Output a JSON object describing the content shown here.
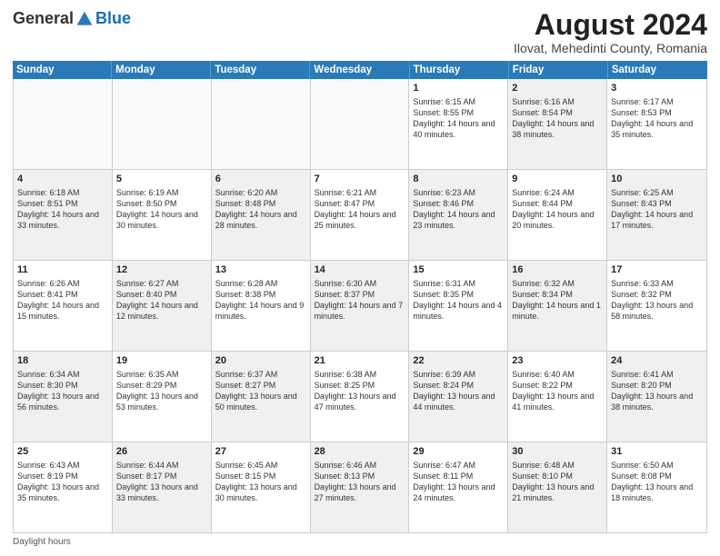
{
  "header": {
    "logo_general": "General",
    "logo_blue": "Blue",
    "title": "August 2024",
    "subtitle": "Ilovat, Mehedinti County, Romania"
  },
  "days_of_week": [
    "Sunday",
    "Monday",
    "Tuesday",
    "Wednesday",
    "Thursday",
    "Friday",
    "Saturday"
  ],
  "footer": "Daylight hours",
  "weeks": [
    [
      {
        "day": "",
        "sunrise": "",
        "sunset": "",
        "daylight": "",
        "shaded": false,
        "empty": true
      },
      {
        "day": "",
        "sunrise": "",
        "sunset": "",
        "daylight": "",
        "shaded": false,
        "empty": true
      },
      {
        "day": "",
        "sunrise": "",
        "sunset": "",
        "daylight": "",
        "shaded": false,
        "empty": true
      },
      {
        "day": "",
        "sunrise": "",
        "sunset": "",
        "daylight": "",
        "shaded": false,
        "empty": true
      },
      {
        "day": "1",
        "sunrise": "Sunrise: 6:15 AM",
        "sunset": "Sunset: 8:55 PM",
        "daylight": "Daylight: 14 hours and 40 minutes.",
        "shaded": false,
        "empty": false
      },
      {
        "day": "2",
        "sunrise": "Sunrise: 6:16 AM",
        "sunset": "Sunset: 8:54 PM",
        "daylight": "Daylight: 14 hours and 38 minutes.",
        "shaded": true,
        "empty": false
      },
      {
        "day": "3",
        "sunrise": "Sunrise: 6:17 AM",
        "sunset": "Sunset: 8:53 PM",
        "daylight": "Daylight: 14 hours and 35 minutes.",
        "shaded": false,
        "empty": false
      }
    ],
    [
      {
        "day": "4",
        "sunrise": "Sunrise: 6:18 AM",
        "sunset": "Sunset: 8:51 PM",
        "daylight": "Daylight: 14 hours and 33 minutes.",
        "shaded": true,
        "empty": false
      },
      {
        "day": "5",
        "sunrise": "Sunrise: 6:19 AM",
        "sunset": "Sunset: 8:50 PM",
        "daylight": "Daylight: 14 hours and 30 minutes.",
        "shaded": false,
        "empty": false
      },
      {
        "day": "6",
        "sunrise": "Sunrise: 6:20 AM",
        "sunset": "Sunset: 8:48 PM",
        "daylight": "Daylight: 14 hours and 28 minutes.",
        "shaded": true,
        "empty": false
      },
      {
        "day": "7",
        "sunrise": "Sunrise: 6:21 AM",
        "sunset": "Sunset: 8:47 PM",
        "daylight": "Daylight: 14 hours and 25 minutes.",
        "shaded": false,
        "empty": false
      },
      {
        "day": "8",
        "sunrise": "Sunrise: 6:23 AM",
        "sunset": "Sunset: 8:46 PM",
        "daylight": "Daylight: 14 hours and 23 minutes.",
        "shaded": true,
        "empty": false
      },
      {
        "day": "9",
        "sunrise": "Sunrise: 6:24 AM",
        "sunset": "Sunset: 8:44 PM",
        "daylight": "Daylight: 14 hours and 20 minutes.",
        "shaded": false,
        "empty": false
      },
      {
        "day": "10",
        "sunrise": "Sunrise: 6:25 AM",
        "sunset": "Sunset: 8:43 PM",
        "daylight": "Daylight: 14 hours and 17 minutes.",
        "shaded": true,
        "empty": false
      }
    ],
    [
      {
        "day": "11",
        "sunrise": "Sunrise: 6:26 AM",
        "sunset": "Sunset: 8:41 PM",
        "daylight": "Daylight: 14 hours and 15 minutes.",
        "shaded": false,
        "empty": false
      },
      {
        "day": "12",
        "sunrise": "Sunrise: 6:27 AM",
        "sunset": "Sunset: 8:40 PM",
        "daylight": "Daylight: 14 hours and 12 minutes.",
        "shaded": true,
        "empty": false
      },
      {
        "day": "13",
        "sunrise": "Sunrise: 6:28 AM",
        "sunset": "Sunset: 8:38 PM",
        "daylight": "Daylight: 14 hours and 9 minutes.",
        "shaded": false,
        "empty": false
      },
      {
        "day": "14",
        "sunrise": "Sunrise: 6:30 AM",
        "sunset": "Sunset: 8:37 PM",
        "daylight": "Daylight: 14 hours and 7 minutes.",
        "shaded": true,
        "empty": false
      },
      {
        "day": "15",
        "sunrise": "Sunrise: 6:31 AM",
        "sunset": "Sunset: 8:35 PM",
        "daylight": "Daylight: 14 hours and 4 minutes.",
        "shaded": false,
        "empty": false
      },
      {
        "day": "16",
        "sunrise": "Sunrise: 6:32 AM",
        "sunset": "Sunset: 8:34 PM",
        "daylight": "Daylight: 14 hours and 1 minute.",
        "shaded": true,
        "empty": false
      },
      {
        "day": "17",
        "sunrise": "Sunrise: 6:33 AM",
        "sunset": "Sunset: 8:32 PM",
        "daylight": "Daylight: 13 hours and 58 minutes.",
        "shaded": false,
        "empty": false
      }
    ],
    [
      {
        "day": "18",
        "sunrise": "Sunrise: 6:34 AM",
        "sunset": "Sunset: 8:30 PM",
        "daylight": "Daylight: 13 hours and 56 minutes.",
        "shaded": true,
        "empty": false
      },
      {
        "day": "19",
        "sunrise": "Sunrise: 6:35 AM",
        "sunset": "Sunset: 8:29 PM",
        "daylight": "Daylight: 13 hours and 53 minutes.",
        "shaded": false,
        "empty": false
      },
      {
        "day": "20",
        "sunrise": "Sunrise: 6:37 AM",
        "sunset": "Sunset: 8:27 PM",
        "daylight": "Daylight: 13 hours and 50 minutes.",
        "shaded": true,
        "empty": false
      },
      {
        "day": "21",
        "sunrise": "Sunrise: 6:38 AM",
        "sunset": "Sunset: 8:25 PM",
        "daylight": "Daylight: 13 hours and 47 minutes.",
        "shaded": false,
        "empty": false
      },
      {
        "day": "22",
        "sunrise": "Sunrise: 6:39 AM",
        "sunset": "Sunset: 8:24 PM",
        "daylight": "Daylight: 13 hours and 44 minutes.",
        "shaded": true,
        "empty": false
      },
      {
        "day": "23",
        "sunrise": "Sunrise: 6:40 AM",
        "sunset": "Sunset: 8:22 PM",
        "daylight": "Daylight: 13 hours and 41 minutes.",
        "shaded": false,
        "empty": false
      },
      {
        "day": "24",
        "sunrise": "Sunrise: 6:41 AM",
        "sunset": "Sunset: 8:20 PM",
        "daylight": "Daylight: 13 hours and 38 minutes.",
        "shaded": true,
        "empty": false
      }
    ],
    [
      {
        "day": "25",
        "sunrise": "Sunrise: 6:43 AM",
        "sunset": "Sunset: 8:19 PM",
        "daylight": "Daylight: 13 hours and 35 minutes.",
        "shaded": false,
        "empty": false
      },
      {
        "day": "26",
        "sunrise": "Sunrise: 6:44 AM",
        "sunset": "Sunset: 8:17 PM",
        "daylight": "Daylight: 13 hours and 33 minutes.",
        "shaded": true,
        "empty": false
      },
      {
        "day": "27",
        "sunrise": "Sunrise: 6:45 AM",
        "sunset": "Sunset: 8:15 PM",
        "daylight": "Daylight: 13 hours and 30 minutes.",
        "shaded": false,
        "empty": false
      },
      {
        "day": "28",
        "sunrise": "Sunrise: 6:46 AM",
        "sunset": "Sunset: 8:13 PM",
        "daylight": "Daylight: 13 hours and 27 minutes.",
        "shaded": true,
        "empty": false
      },
      {
        "day": "29",
        "sunrise": "Sunrise: 6:47 AM",
        "sunset": "Sunset: 8:11 PM",
        "daylight": "Daylight: 13 hours and 24 minutes.",
        "shaded": false,
        "empty": false
      },
      {
        "day": "30",
        "sunrise": "Sunrise: 6:48 AM",
        "sunset": "Sunset: 8:10 PM",
        "daylight": "Daylight: 13 hours and 21 minutes.",
        "shaded": true,
        "empty": false
      },
      {
        "day": "31",
        "sunrise": "Sunrise: 6:50 AM",
        "sunset": "Sunset: 8:08 PM",
        "daylight": "Daylight: 13 hours and 18 minutes.",
        "shaded": false,
        "empty": false
      }
    ]
  ]
}
